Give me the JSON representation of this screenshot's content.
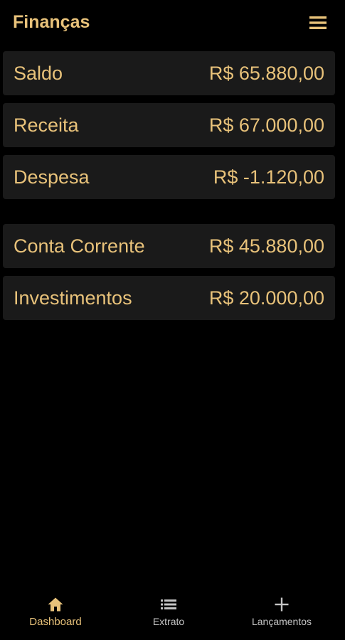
{
  "header": {
    "title": "Finanças",
    "menu_icon": "hamburger-menu-icon"
  },
  "summary": [
    {
      "label": "Saldo",
      "value": "R$ 65.880,00"
    },
    {
      "label": "Receita",
      "value": "R$ 67.000,00"
    },
    {
      "label": "Despesa",
      "value": "R$ -1.120,00"
    }
  ],
  "accounts": [
    {
      "label": "Conta Corrente",
      "value": "R$ 45.880,00"
    },
    {
      "label": "Investimentos",
      "value": "R$ 20.000,00"
    }
  ],
  "bottom_nav": {
    "items": [
      {
        "label": "Dashboard",
        "icon": "home-icon",
        "active": true
      },
      {
        "label": "Extrato",
        "icon": "list-icon",
        "active": false
      },
      {
        "label": "Lançamentos",
        "icon": "plus-icon",
        "active": false
      }
    ]
  },
  "colors": {
    "accent": "#e8c27a",
    "background": "#000000",
    "card": "#1a1a1a",
    "nav_inactive": "#c4c4c4"
  }
}
